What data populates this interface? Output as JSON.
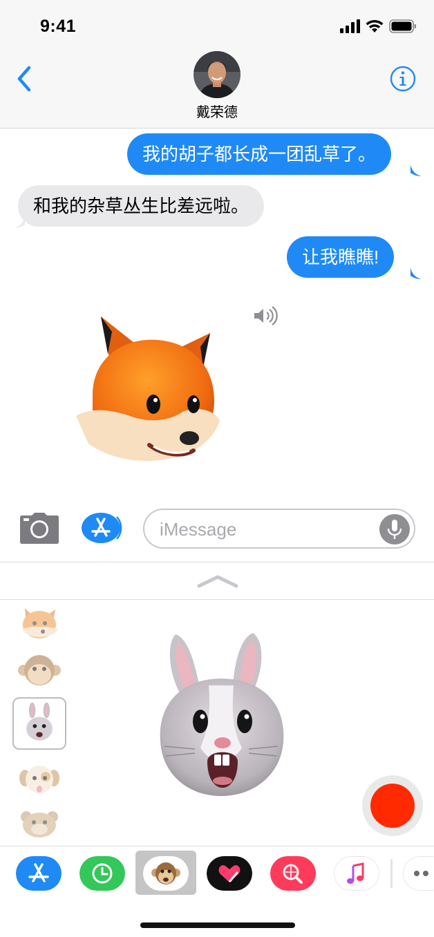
{
  "status_bar": {
    "time": "9:41"
  },
  "header": {
    "contact_name": "戴荣德"
  },
  "messages": [
    {
      "direction": "outgoing",
      "text": "我的胡子都长成一团乱草了。"
    },
    {
      "direction": "incoming",
      "text": "和我的杂草丛生比差远啦。"
    },
    {
      "direction": "outgoing",
      "text": "让我瞧瞧!"
    }
  ],
  "input": {
    "placeholder": "iMessage"
  },
  "animoji_panel": {
    "characters": [
      "fox",
      "monkey",
      "rabbit",
      "dog",
      "bear"
    ],
    "selected": "rabbit"
  },
  "app_drawer": {
    "apps": [
      "app-store",
      "recents",
      "animoji",
      "digital-touch",
      "images-search",
      "music",
      "more"
    ],
    "selected": "animoji"
  },
  "colors": {
    "accent": "#1f8af5",
    "incoming_bubble": "#e9e9eb",
    "record": "#ff2a00"
  }
}
